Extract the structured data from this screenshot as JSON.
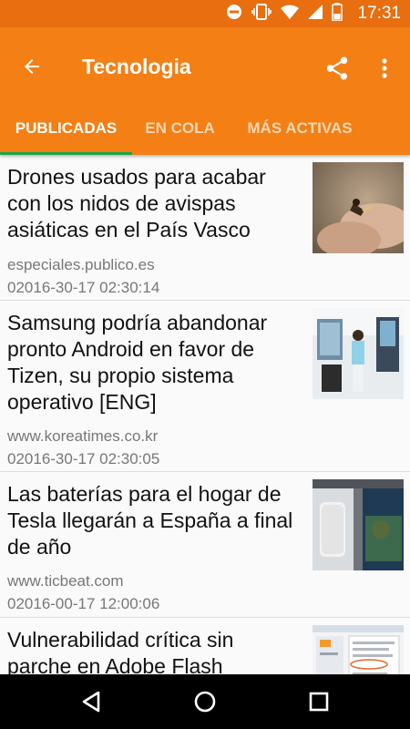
{
  "status_bar": {
    "time": "17:31",
    "icons": [
      "do-not-disturb-icon",
      "vibrate-icon",
      "wifi-icon",
      "signal-icon",
      "battery-icon"
    ]
  },
  "app_bar": {
    "title": "Tecnologia",
    "back_icon": "arrow-back-icon",
    "share_icon": "share-icon",
    "menu_icon": "more-vert-icon"
  },
  "tabs": [
    {
      "label": "PUBLICADAS",
      "active": true
    },
    {
      "label": "EN COLA",
      "active": false
    },
    {
      "label": "MÁS ACTIVAS",
      "active": false
    }
  ],
  "articles": [
    {
      "title": "Drones usados para acabar con los nidos de avispas asiáticas en el País Vasco",
      "source": "especiales.publico.es",
      "date": "02016-30-17 02:30:14",
      "thumbnail": "hornet-on-fingers-photo"
    },
    {
      "title": "Samsung podría abandonar pronto Android en favor de Tizen, su propio sistema operativo [ENG]",
      "source": "www.koreatimes.co.kr",
      "date": "02016-30-17 02:30:05",
      "thumbnail": "samsung-booth-photo"
    },
    {
      "title": "Las baterías para el hogar de Tesla llegarán a España a final de año",
      "source": "www.ticbeat.com",
      "date": "02016-00-17 12:00:06",
      "thumbnail": "tesla-powerwall-photo"
    },
    {
      "title": "Vulnerabilidad crítica sin parche en Adobe Flash",
      "source": "",
      "date": "",
      "thumbnail": "flash-settings-screenshot"
    }
  ],
  "nav_bar": {
    "back": "nav-back-icon",
    "home": "nav-home-icon",
    "recents": "nav-recents-icon"
  },
  "colors": {
    "status_bar": "#e86e10",
    "app_bar": "#f37f15",
    "tab_indicator": "#1ba548"
  }
}
